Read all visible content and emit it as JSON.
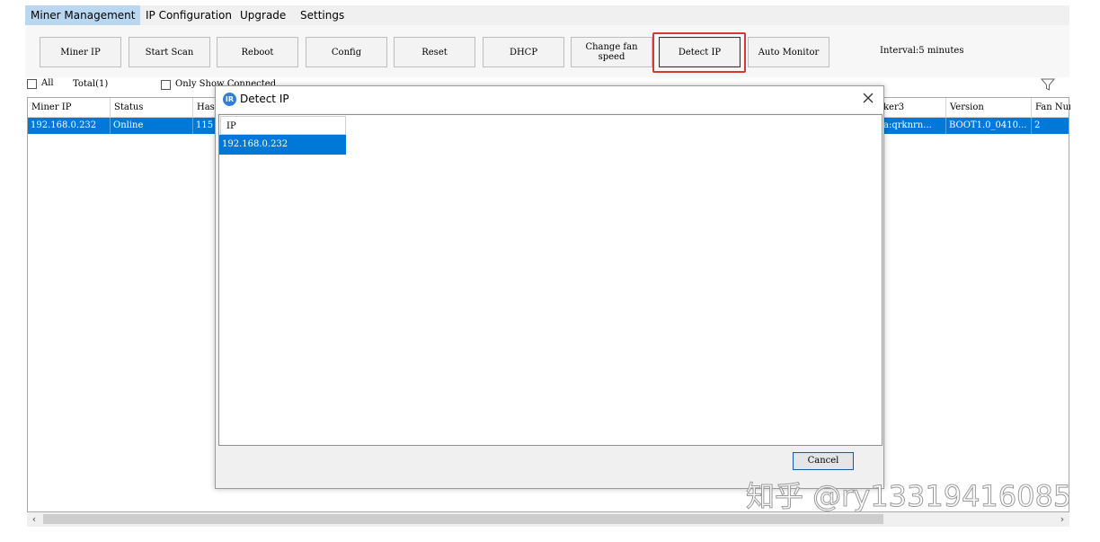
{
  "menu": {
    "items": [
      "Miner Management",
      "IP Configuration",
      "Upgrade",
      "Settings"
    ]
  },
  "toolbar": {
    "buttons": [
      "Miner IP",
      "Start Scan",
      "Reboot",
      "Config",
      "Reset",
      "DHCP",
      "Change fan speed",
      "Detect IP",
      "Auto Monitor"
    ],
    "interval": "Interval:5 minutes"
  },
  "options": {
    "all_label": "All",
    "total": "Total(1)",
    "only_show_connected": "Only Show Connected"
  },
  "table": {
    "headers": [
      "Miner IP",
      "Status",
      "Has",
      "ker3",
      "Version",
      "Fan Num"
    ],
    "row": [
      "192.168.0.232",
      "Online",
      "115",
      "a:qrknrn...",
      "BOOT1.0_0410...",
      "2"
    ]
  },
  "dialog": {
    "title": "Detect IP",
    "logo": "IR",
    "column": "IP",
    "rows": [
      "192.168.0.232"
    ],
    "cancel_label": "Cancel"
  },
  "watermark": "知乎 @ry13319416085",
  "colors": {
    "selection": "#0078d7",
    "highlight": "#d63a2f",
    "active_tab": "#b9d7f1"
  }
}
